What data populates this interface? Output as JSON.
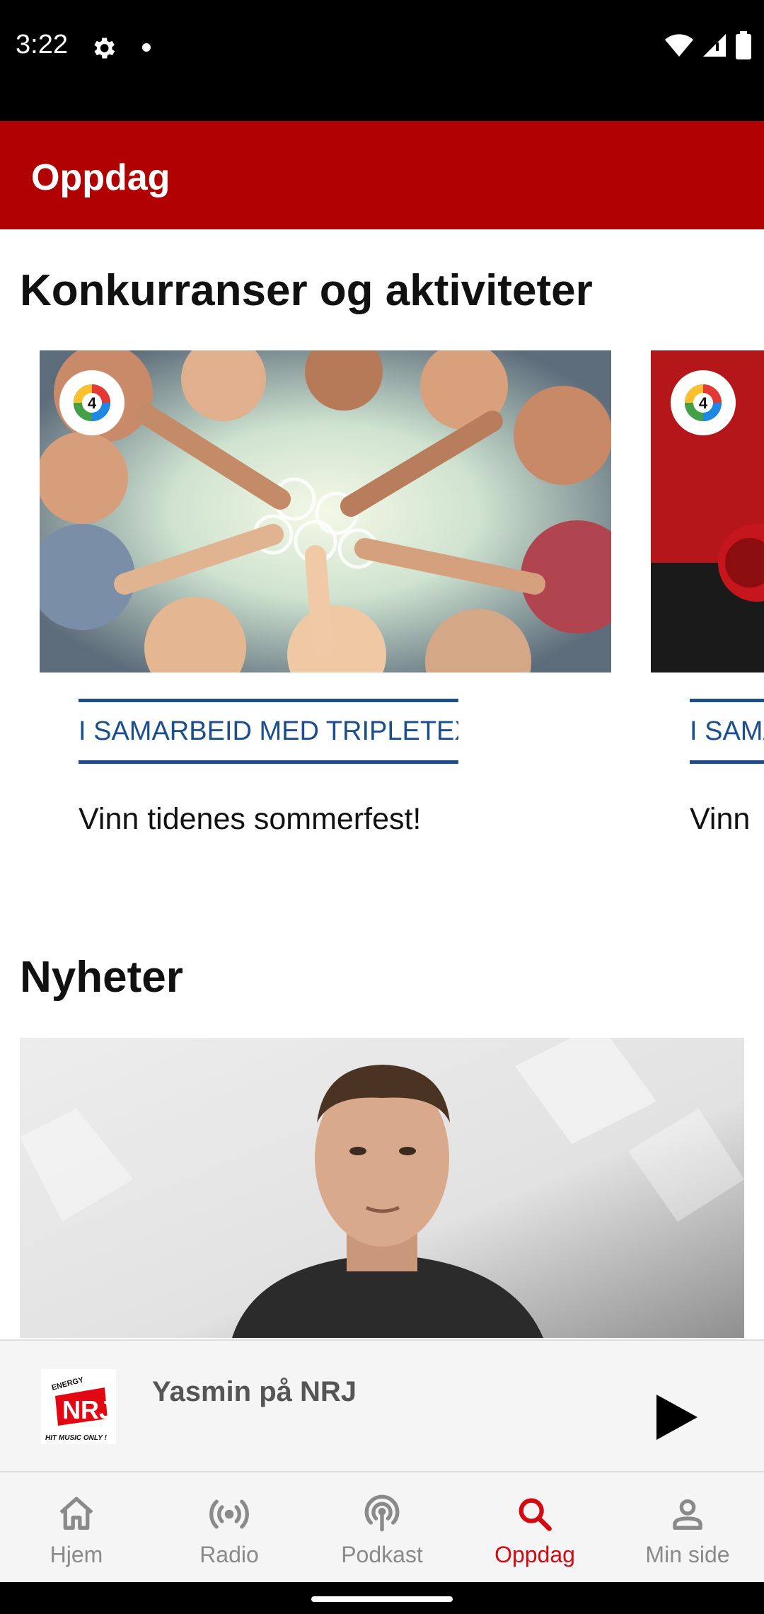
{
  "status_bar": {
    "time": "3:22"
  },
  "app_bar": {
    "title": "Oppdag"
  },
  "competitions": {
    "title": "Konkurranser og aktiviteter",
    "cards": [
      {
        "tag": "I SAMARBEID MED TRIPLETEX",
        "title": "Vinn tidenes sommerfest!"
      },
      {
        "tag": "I SAMARBEID MED",
        "title": "Vinn"
      }
    ]
  },
  "news": {
    "title": "Nyheter"
  },
  "mini_player": {
    "title": "Yasmin på NRJ",
    "logo": {
      "brand": "NRJ",
      "top": "ENERGY",
      "tagline": "HIT MUSIC ONLY !"
    }
  },
  "bottom_nav": {
    "items": [
      {
        "label": "Hjem",
        "icon": "home-icon"
      },
      {
        "label": "Radio",
        "icon": "radio-icon"
      },
      {
        "label": "Podkast",
        "icon": "podcast-icon"
      },
      {
        "label": "Oppdag",
        "icon": "search-icon",
        "active": true
      },
      {
        "label": "Min side",
        "icon": "person-icon"
      }
    ]
  },
  "colors": {
    "brand_red": "#b00202",
    "active_red": "#d20a11",
    "tag_blue": "#1b4e8c"
  }
}
